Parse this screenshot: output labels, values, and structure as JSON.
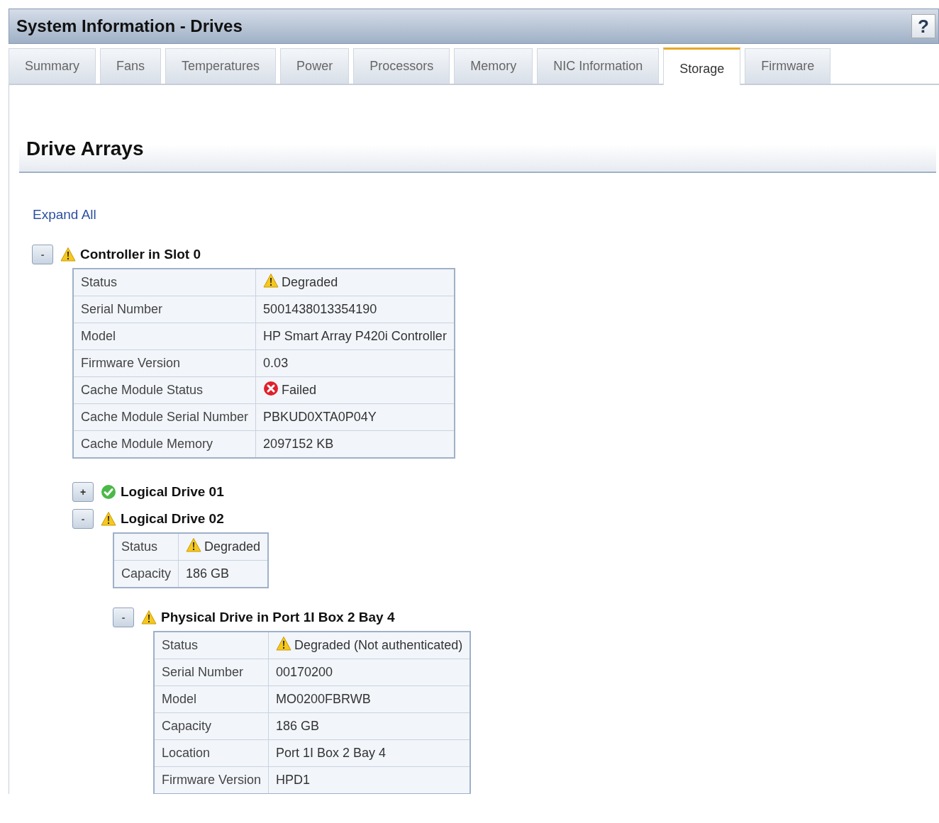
{
  "window": {
    "title": "System Information - Drives",
    "help": "?"
  },
  "tabs": [
    {
      "label": "Summary",
      "selected": false
    },
    {
      "label": "Fans",
      "selected": false
    },
    {
      "label": "Temperatures",
      "selected": false
    },
    {
      "label": "Power",
      "selected": false
    },
    {
      "label": "Processors",
      "selected": false
    },
    {
      "label": "Memory",
      "selected": false
    },
    {
      "label": "NIC Information",
      "selected": false
    },
    {
      "label": "Storage",
      "selected": true
    },
    {
      "label": "Firmware",
      "selected": false
    }
  ],
  "section": {
    "heading": "Drive Arrays",
    "expand_all": "Expand All"
  },
  "tree": [
    {
      "title": "Controller in Slot 0",
      "toggle": "-",
      "expanded": true,
      "kind": "warning",
      "properties": [
        {
          "label": "Status",
          "value": "Degraded",
          "kind": "warning"
        },
        {
          "label": "Serial Number",
          "value": "5001438013354190"
        },
        {
          "label": "Model",
          "value": "HP Smart Array P420i Controller"
        },
        {
          "label": "Firmware Version",
          "value": "0.03"
        },
        {
          "label": "Cache Module Status",
          "value": "Failed",
          "kind": "failed"
        },
        {
          "label": "Cache Module Serial Number",
          "value": "PBKUD0XTA0P04Y"
        },
        {
          "label": "Cache Module Memory",
          "value": "2097152 KB"
        }
      ],
      "children": [
        {
          "title": "Logical Drive 01",
          "toggle": "+",
          "expanded": false,
          "kind": "ok"
        },
        {
          "title": "Logical Drive 02",
          "toggle": "-",
          "expanded": true,
          "kind": "warning",
          "properties": [
            {
              "label": "Status",
              "value": "Degraded",
              "kind": "warning"
            },
            {
              "label": "Capacity",
              "value": "186 GB"
            }
          ],
          "children": [
            {
              "title": "Physical Drive in Port 1I Box 2 Bay 4",
              "toggle": "-",
              "expanded": true,
              "kind": "warning",
              "properties": [
                {
                  "label": "Status",
                  "value": "Degraded (Not authenticated)",
                  "kind": "warning"
                },
                {
                  "label": "Serial Number",
                  "value": "00170200"
                },
                {
                  "label": "Model",
                  "value": "MO0200FBRWB"
                },
                {
                  "label": "Capacity",
                  "value": "186 GB"
                },
                {
                  "label": "Location",
                  "value": "Port 1I Box 2 Bay 4"
                },
                {
                  "label": "Firmware Version",
                  "value": "HPD1"
                }
              ]
            }
          ]
        }
      ]
    }
  ]
}
